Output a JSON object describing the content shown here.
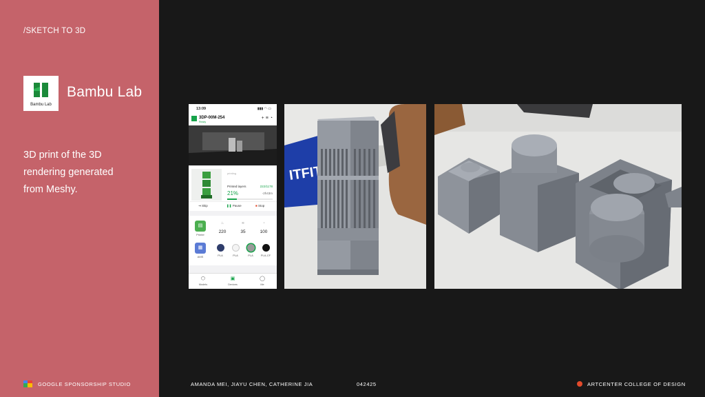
{
  "section": {
    "label": "/SKETCH TO 3D"
  },
  "brand": {
    "logo_text": "Bambu Lab",
    "name": "Bambu Lab",
    "accent": "#c5636a",
    "logo_green": "#1b8a3a"
  },
  "description": "3D print of the 3D rendering generated from Meshy.",
  "footer": {
    "studio": "GOOGLE SPONSORSHIP STUDIO",
    "authors": "AMANDA MEI, JIAYU CHEN, CATHERINE JIA",
    "date": "042425",
    "school": "ARTCENTER COLLEGE OF DESIGN"
  },
  "phone": {
    "time": "13:09",
    "device_name": "3DP-00M-254",
    "device_sub": "Ready",
    "model_status": "printing",
    "layers_label": "Printed layers",
    "layers_value": "222/1178",
    "progress_text": "21%",
    "progress": 0.21,
    "eta": "-2h43m",
    "controls": {
      "skip": "Skip",
      "pause": "Pause",
      "stop": "Stop"
    },
    "printer_label": "Printer",
    "ams_label": "AMS",
    "stats": [
      {
        "icon": "nozzle-temp-icon",
        "value": "220"
      },
      {
        "icon": "bed-temp-icon",
        "value": "35"
      },
      {
        "icon": "speed-icon",
        "value": "100"
      }
    ],
    "filaments": [
      {
        "label": "PLA",
        "color": "#2f3d6b"
      },
      {
        "label": "PLA",
        "color": "#f4f4f4"
      },
      {
        "label": "PLA",
        "color": "#9a9a9a"
      },
      {
        "label": "PLA-CF",
        "color": "#111111"
      }
    ],
    "tabs": [
      {
        "icon": "models-icon",
        "label": "Models"
      },
      {
        "icon": "devices-icon",
        "label": "Devices"
      },
      {
        "icon": "me-icon",
        "label": "Me"
      }
    ]
  }
}
